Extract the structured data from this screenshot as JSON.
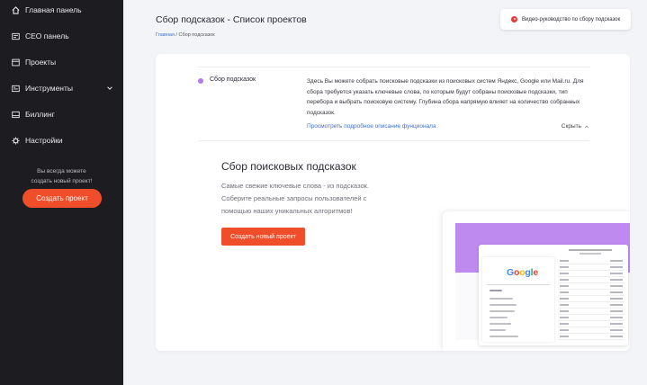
{
  "sidebar": {
    "items": [
      {
        "label": "Главная панель",
        "icon": "home-icon"
      },
      {
        "label": "СЕО панель",
        "icon": "seo-panel-icon"
      },
      {
        "label": "Проекты",
        "icon": "projects-icon"
      },
      {
        "label": "Инструменты",
        "icon": "tools-icon"
      },
      {
        "label": "Биллинг",
        "icon": "billing-icon"
      },
      {
        "label": "Настройки",
        "icon": "gear-icon"
      }
    ],
    "note_line1": "Вы всегда можете",
    "note_line2": "создать новый проект!",
    "cta_label": "Создать проект"
  },
  "header": {
    "title": "Сбор подсказок - Список проектов",
    "breadcrumb_home": "Главная",
    "breadcrumb_separator": "/",
    "breadcrumb_current": "Сбор подсказок",
    "video_button_label": "Видео-руководство по сбору подсказок"
  },
  "info": {
    "label": "Сбор подсказок",
    "text": "Здесь Вы можете собрать поисковые подсказки из поисковых систем Яндекс, Google или Mail.ru. Для сбора требуется указать ключевые слова, по которым будут собраны поисковые подсказки, тип перебора и выбрать поисковую систему. Глубина сбора напрямую влияет на количество собранных подсказок.",
    "link": "Просмотреть подробное описание фунционала",
    "collapse_label": "Скрыть"
  },
  "promo": {
    "title": "Сбор поисковых подсказок",
    "text": "Самые свежие ключевые слова - из подсказок. Соберите реальные запросы пользователей с помощью наших уникальных алгоритмов!",
    "cta_label": "Создать новый проект"
  },
  "illustration": {
    "logo_letters": [
      "G",
      "o",
      "o",
      "g",
      "l",
      "e"
    ],
    "logo_colors": [
      "#4285F4",
      "#EA4335",
      "#FBBC05",
      "#4285F4",
      "#34A853",
      "#EA4335"
    ]
  },
  "colors": {
    "sidebar_bg": "#1d1d21",
    "accent": "#f04e2a",
    "link": "#3b6fd6",
    "bullet": "#b57ae6",
    "illustration_band": "#bf8af0"
  }
}
